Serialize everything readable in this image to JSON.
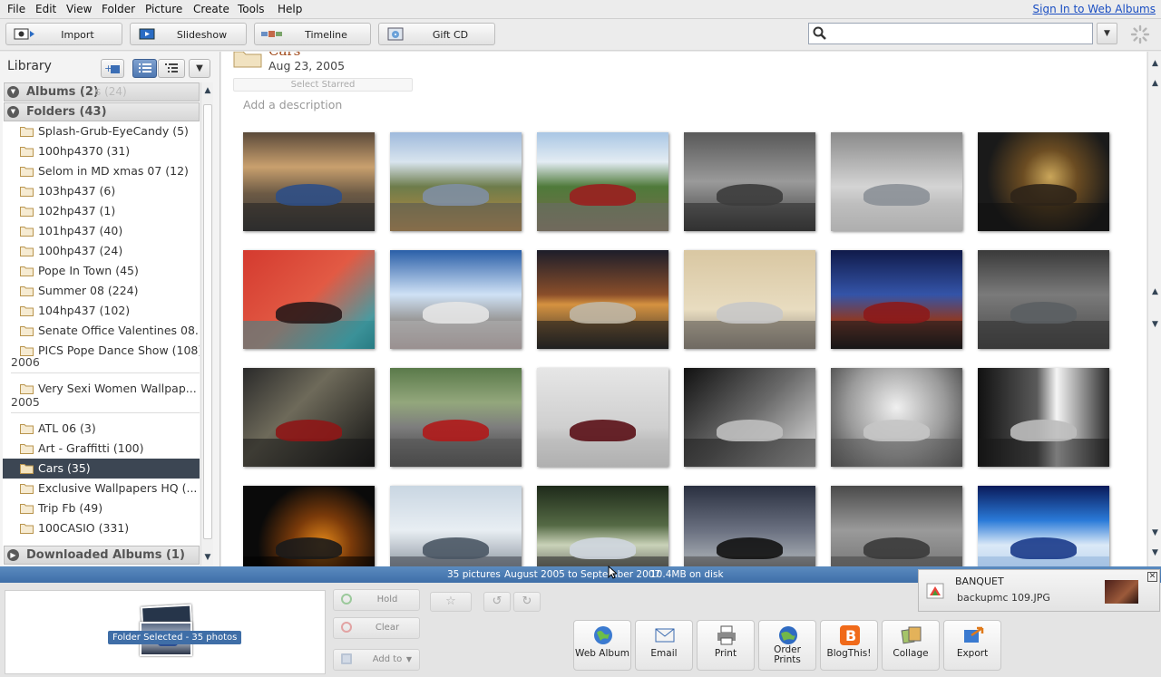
{
  "menubar": {
    "items": [
      "File",
      "Edit",
      "View",
      "Folder",
      "Picture",
      "Create",
      "Tools",
      "Help"
    ],
    "sign_in": "Sign In to Web Albums"
  },
  "toolbar": {
    "import": "Import",
    "slideshow": "Slideshow",
    "timeline": "Timeline",
    "gift_cd": "Gift CD",
    "search_value": "",
    "search_mode_icon": "chevron-down-icon"
  },
  "library": {
    "title": "Library",
    "albums_header": "Albums (2)",
    "albums_hidden_count": "s (24)",
    "folders_header": "Folders (43)",
    "undated_folders": [
      "Splash-Grub-EyeCandy (5)",
      "100hp4370 (31)",
      "Selom in MD xmas 07 (12)",
      "103hp437 (6)",
      "102hp437 (1)",
      "101hp437 (40)",
      "100hp437 (24)",
      "Pope In Town (45)",
      "Summer 08 (224)",
      "104hp437 (102)",
      "Senate Office Valentines 08...",
      "PICS Pope Dance Show (108)"
    ],
    "year_2006": "2006",
    "folders_2006": [
      "Very Sexi Women Wallpap..."
    ],
    "year_2005": "2005",
    "folders_2005": [
      "ATL 06 (3)",
      "Art - Graffitti (100)",
      "Cars (35)",
      "Exclusive Wallpapers HQ (...",
      "Trip Fb (49)",
      "100CASIO (331)"
    ],
    "selected_folder": "Cars (35)",
    "downloaded_header": "Downloaded Albums (1)"
  },
  "content": {
    "folder_name": "Cars",
    "folder_date": "Aug 23, 2005",
    "select_starred": "Select Starred",
    "description_placeholder": "Add a description",
    "thumbnails": [
      {
        "name": "aston-martin-sunset",
        "bg": "linear-gradient(180deg,#5b4a3a 0%,#c9a06e 35%,#6c5a45 62%,#3a3a3a 100%)",
        "car": "#2f4f86",
        "road": "#222"
      },
      {
        "name": "aston-martin-road",
        "bg": "linear-gradient(180deg,#9fbadc 0%,#d8e4ee 30%,#6d7c4b 55%,#c28a3c 100%)",
        "car": "#7f8fa3",
        "road": "#555"
      },
      {
        "name": "red-car-motion",
        "bg": "linear-gradient(180deg,#a9c6e4 0%,#e3ecf3 30%,#4f7a3a 55%,#7a6a4d 100%)",
        "car": "#9a1f1f",
        "road": "#6a6a6a"
      },
      {
        "name": "bronco-concept",
        "bg": "linear-gradient(180deg,#585858 0%,#9a9a9a 50%,#3b3b3b 100%)",
        "car": "#3c3c3c",
        "road": "#2a2a2a"
      },
      {
        "name": "bmw-concept",
        "bg": "linear-gradient(180deg,#8a8a8a 0%,#d4d4d4 55%,#9c9c9c 100%)",
        "car": "#8b9097",
        "road": "#bdbdbd"
      },
      {
        "name": "car-interior",
        "bg": "radial-gradient(circle at 55% 45%,#caa65a 0%,#6b4c22 30%,#1a1a1a 70%)",
        "car": "#2e2418",
        "road": "#111"
      },
      {
        "name": "falcon-taillight",
        "bg": "linear-gradient(135deg,#d43a2f 0%,#e25a44 50%,#4a9aa0 85%,#1f6a72 100%)",
        "car": "#2a1a1a",
        "road": "#2f8a92"
      },
      {
        "name": "white-racer",
        "bg": "linear-gradient(180deg,#2a5fa8 0%,#cfe1f5 45%,#9a9a9a 70%,#7e6a6a 100%)",
        "car": "#e6e6e6",
        "road": "#b0b0b0"
      },
      {
        "name": "dusk-sportscar",
        "bg": "linear-gradient(180deg,#1d1d2a 0%,#8a4e2a 45%,#d59240 55%,#2a2a2a 100%)",
        "car": "#bfb6a5",
        "road": "#1a1a1a"
      },
      {
        "name": "building-car",
        "bg": "linear-gradient(180deg,#d9c7a2 0%,#e8dcc0 60%,#8a8278 100%)",
        "car": "#c8c8c8",
        "road": "#5a5650"
      },
      {
        "name": "lincoln-towers",
        "bg": "linear-gradient(180deg,#101a4a 0%,#3454a8 45%,#8a3a2a 70%,#141414 100%)",
        "car": "#8c1a1a",
        "road": "#1a1a1a"
      },
      {
        "name": "grey-coupe",
        "bg": "linear-gradient(180deg,#3a3a3a 0%,#7a7a7a 45%,#4a4a4a 100%)",
        "car": "#5b5f63",
        "road": "#2c2c2c"
      },
      {
        "name": "red-sportscar-dark",
        "bg": "linear-gradient(135deg,#2a2a2a 0%,#6e6a5a 40%,#111 100%)",
        "car": "#8e1616",
        "road": "#151515"
      },
      {
        "name": "red-car-curve",
        "bg": "linear-gradient(180deg,#5a7a4a 0%,#93a77c 35%,#7d7d7d 60%,#3a3a3a 100%)",
        "car": "#b01a1a",
        "road": "#555"
      },
      {
        "name": "hotrod",
        "bg": "linear-gradient(180deg,#e6e6e6 0%,#cfcfcf 60%,#a0a0a0 100%)",
        "car": "#5a1016",
        "road": "#bdbdbd"
      },
      {
        "name": "audi-r8-tunnel",
        "bg": "linear-gradient(135deg,#111 0%,#6a6a6a 50%,#e3e3e3 100%)",
        "car": "#bfbfbf",
        "road": "#1d1d1d"
      },
      {
        "name": "audi-r8-front",
        "bg": "radial-gradient(circle at 50% 40%,#f0f0f0 0%,#9a9a9a 55%,#3a3a3a 100%)",
        "car": "#c5c5c5",
        "road": "#555"
      },
      {
        "name": "audi-r8-rear",
        "bg": "linear-gradient(90deg,#111 0%,#5a5a5a 45%,#f5f5f5 60%,#2a2a2a 100%)",
        "car": "#bcbcbc",
        "road": "#181818"
      },
      {
        "name": "speedometer",
        "bg": "radial-gradient(circle at 60% 60%,#e68a1a 0%,#7a3a0a 30%,#0a0a0a 65%)",
        "car": "#1a1a1a",
        "road": "#000"
      },
      {
        "name": "le-mans-prototype",
        "bg": "linear-gradient(180deg,#c9d6e2 0%,#e8eef3 45%,#6a7480 100%)",
        "car": "#4a5664",
        "road": "#3b4048"
      },
      {
        "name": "shelby-gt",
        "bg": "linear-gradient(180deg,#1e2a1a 0%,#556a45 40%,#c9d2b8 60%,#3a3a3a 100%)",
        "car": "#cfd6df",
        "road": "#2a2a2a"
      },
      {
        "name": "black-aston",
        "bg": "linear-gradient(180deg,#2a3040 0%,#6a7080 45%,#9aa0a8 70%,#3a3a3a 100%)",
        "car": "#121212",
        "road": "#505050"
      },
      {
        "name": "coupe-motion-blur",
        "bg": "linear-gradient(180deg,#4a4a4a 0%,#9a9a9a 45%,#6a6a6a 100%)",
        "car": "#3a3a3a",
        "road": "#444"
      },
      {
        "name": "blue-car-blur",
        "bg": "linear-gradient(180deg,#0a1a5a 0%,#2a7ad8 35%,#dbe9f7 60%,#a9c7e8 100%)",
        "car": "#1a3a8a",
        "road": "#8fb3da"
      }
    ]
  },
  "status": {
    "count": "35 pictures",
    "range": "August 2005 to September 2007",
    "size": "10.4MB on disk"
  },
  "tray": {
    "selection_label": "Folder Selected - 35 photos",
    "hold": "Hold",
    "clear": "Clear",
    "add_to": "Add to"
  },
  "actions": [
    "Web Album",
    "Email",
    "Print",
    "Order Prints",
    "BlogThis!",
    "Collage",
    "Export"
  ],
  "notification": {
    "title": "BANQUET",
    "subtitle": "backupmc 109.JPG"
  }
}
